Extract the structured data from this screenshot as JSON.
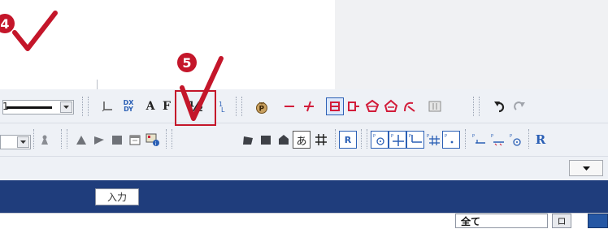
{
  "markers": {
    "step4": "4",
    "step5": "5"
  },
  "toolbar1": {
    "line_width_value": "1",
    "tool_text_a": "A",
    "tool_text_b": "F",
    "fraction_tool": "½",
    "dx_tool_top": "DX",
    "dx_tool_bottom": "DY"
  },
  "toolbar2": {
    "tool_a_char": "あ",
    "tool_r_char": "R",
    "tool_r2_char": "R"
  },
  "tab_bar": {
    "input_tab_label": "入力"
  },
  "bottom": {
    "filter_label": "全て",
    "pin_label": "ロ"
  },
  "colors": {
    "navy": "#1f3d7c",
    "marker_red": "#c4162a",
    "toolbar_bg": "#eef1f6",
    "accent_blue": "#2a5fb5"
  }
}
